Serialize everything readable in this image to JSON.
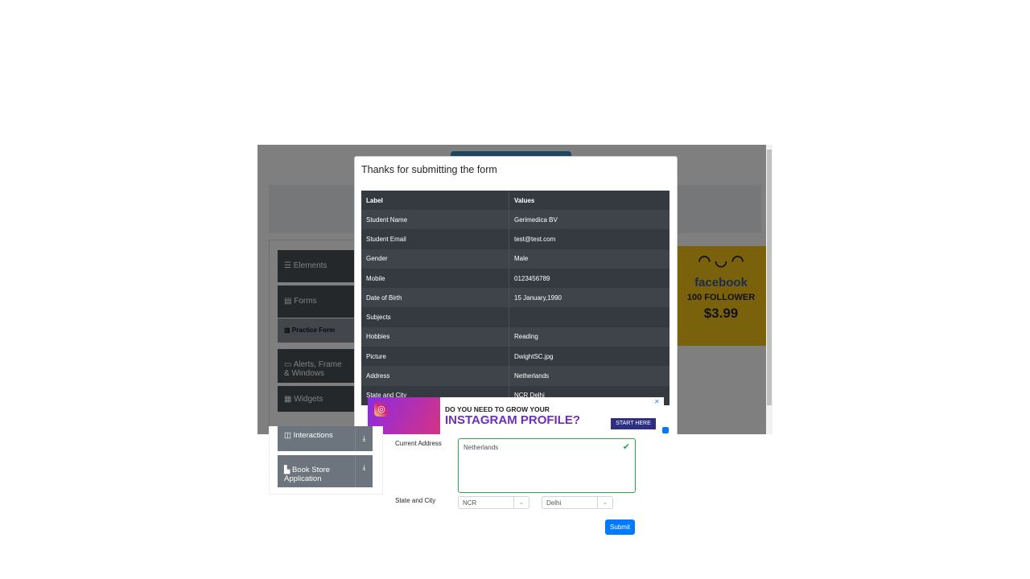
{
  "modal": {
    "title": "Thanks for submitting the form",
    "table": {
      "headers": [
        "Label",
        "Values"
      ],
      "rows": [
        [
          "Student Name",
          "Gerimedica BV"
        ],
        [
          "Student Email",
          "test@test.com"
        ],
        [
          "Gender",
          "Male"
        ],
        [
          "Mobile",
          "0123456789"
        ],
        [
          "Date of Birth",
          "15 January,1990"
        ],
        [
          "Subjects",
          ""
        ],
        [
          "Hobbies",
          "Reading"
        ],
        [
          "Picture",
          "DwightSC.jpg"
        ],
        [
          "Address",
          "Netherlands"
        ],
        [
          "State and City",
          "NCR Delhi"
        ]
      ]
    }
  },
  "sidebar": {
    "items": [
      {
        "label": "Elements",
        "icon": "list-icon"
      },
      {
        "label": "Forms",
        "icon": "form-icon"
      },
      {
        "label": "Practice Form",
        "icon": "document-icon"
      },
      {
        "label": "Alerts, Frame & Windows",
        "icon": "window-icon"
      },
      {
        "label": "Widgets",
        "icon": "grid-icon"
      },
      {
        "label": "Interactions",
        "icon": "interaction-icon"
      },
      {
        "label": "Book Store Application",
        "icon": "book-icon"
      }
    ]
  },
  "ads": {
    "facebook": {
      "brand": "facebook",
      "line2": "100 FOLLOWER",
      "price": "$3.99"
    },
    "instagram": {
      "line1": "DO YOU NEED TO GROW YOUR",
      "line2": "INSTAGRAM PROFILE?",
      "cta": "START HERE",
      "close": "✕"
    }
  },
  "form": {
    "current_address_label": "Current Address",
    "current_address_value": "Netherlands",
    "state_city_label": "State and City",
    "state_value": "NCR",
    "city_value": "Delhi",
    "submit_label": "Submit"
  },
  "colors": {
    "accent": "#007bff",
    "valid": "#28a745",
    "table_dark": "#343a40"
  }
}
